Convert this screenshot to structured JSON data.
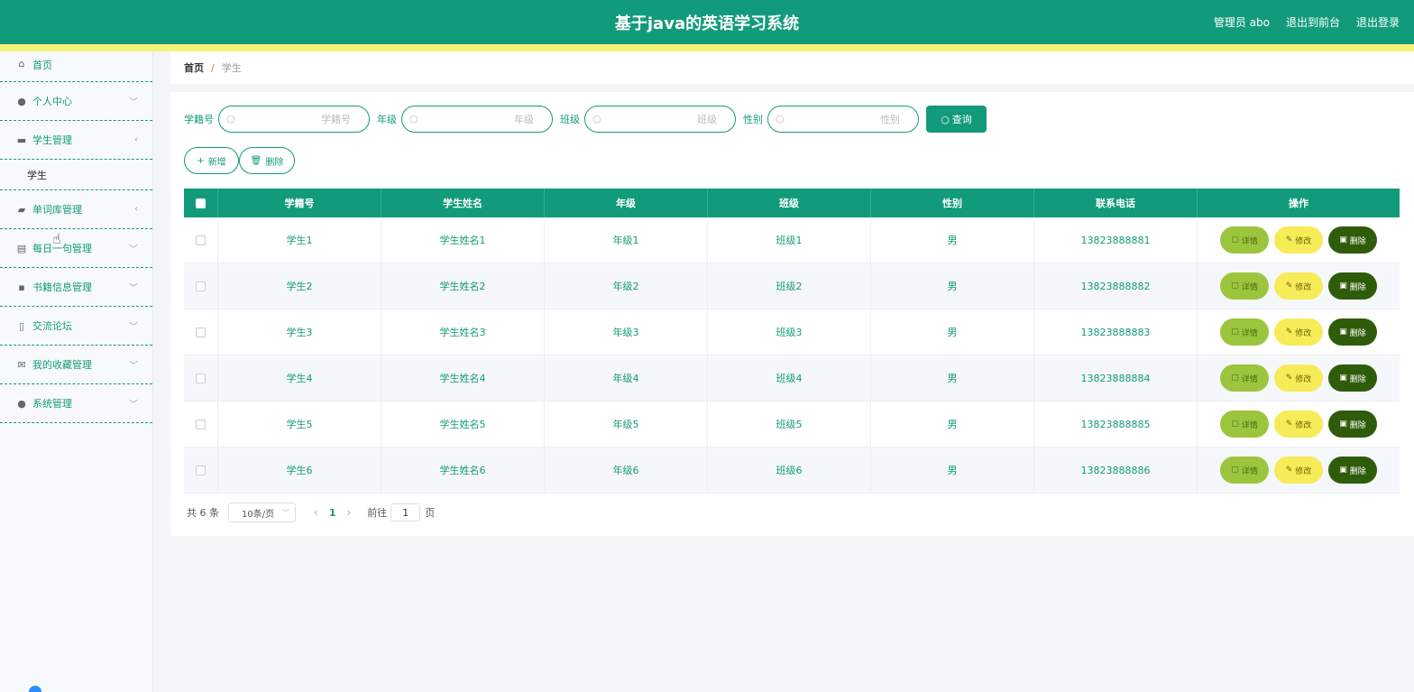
{
  "header": {
    "title": "基于java的英语学习系统",
    "user": "管理员 abo",
    "to_front": "退出到前台",
    "logout": "退出登录"
  },
  "sidebar": {
    "items": [
      {
        "label": "首页",
        "icon": "home-icon"
      },
      {
        "label": "个人中心",
        "icon": "user-icon"
      },
      {
        "label": "学生管理",
        "icon": "ticket-icon",
        "submenu": [
          "学生"
        ]
      },
      {
        "label": "单词库管理",
        "icon": "thumb-icon"
      },
      {
        "label": "每日一句管理",
        "icon": "briefcase-icon"
      },
      {
        "label": "书籍信息管理",
        "icon": "message-icon"
      },
      {
        "label": "交流论坛",
        "icon": "mic-icon"
      },
      {
        "label": "我的收藏管理",
        "icon": "mail-icon"
      },
      {
        "label": "系统管理",
        "icon": "bulb-icon"
      }
    ]
  },
  "breadcrumb": {
    "home": "首页",
    "separator": "/",
    "current": "学生"
  },
  "search": {
    "fields": [
      {
        "label": "学籍号",
        "placeholder": "学籍号"
      },
      {
        "label": "年级",
        "placeholder": "年级"
      },
      {
        "label": "班级",
        "placeholder": "班级"
      },
      {
        "label": "性别",
        "placeholder": "性别"
      }
    ],
    "query_label": "查询"
  },
  "actions": {
    "add_label": "新增",
    "delete_label": "删除"
  },
  "table": {
    "headers": [
      "学籍号",
      "学生姓名",
      "年级",
      "班级",
      "性别",
      "联系电话",
      "操作"
    ],
    "rows": [
      [
        "学生1",
        "学生姓名1",
        "年级1",
        "班级1",
        "男",
        "13823888881"
      ],
      [
        "学生2",
        "学生姓名2",
        "年级2",
        "班级2",
        "男",
        "13823888882"
      ],
      [
        "学生3",
        "学生姓名3",
        "年级3",
        "班级3",
        "男",
        "13823888883"
      ],
      [
        "学生4",
        "学生姓名4",
        "年级4",
        "班级4",
        "男",
        "13823888884"
      ],
      [
        "学生5",
        "学生姓名5",
        "年级5",
        "班级5",
        "男",
        "13823888885"
      ],
      [
        "学生6",
        "学生姓名6",
        "年级6",
        "班级6",
        "男",
        "13823888886"
      ]
    ],
    "row_actions": {
      "detail": "详情",
      "edit": "修改",
      "delete": "删除"
    }
  },
  "pagination": {
    "total": "共 6 条",
    "page_size": "10条/页",
    "current_page": "1",
    "goto_prefix": "前往",
    "goto_value": "1",
    "goto_suffix": "页"
  },
  "colors": {
    "primary": "#129b7a",
    "stripe": "#f5f27a",
    "detail": "#9bc53d",
    "edit": "#f5ec58",
    "delete": "#2f5c0a"
  }
}
